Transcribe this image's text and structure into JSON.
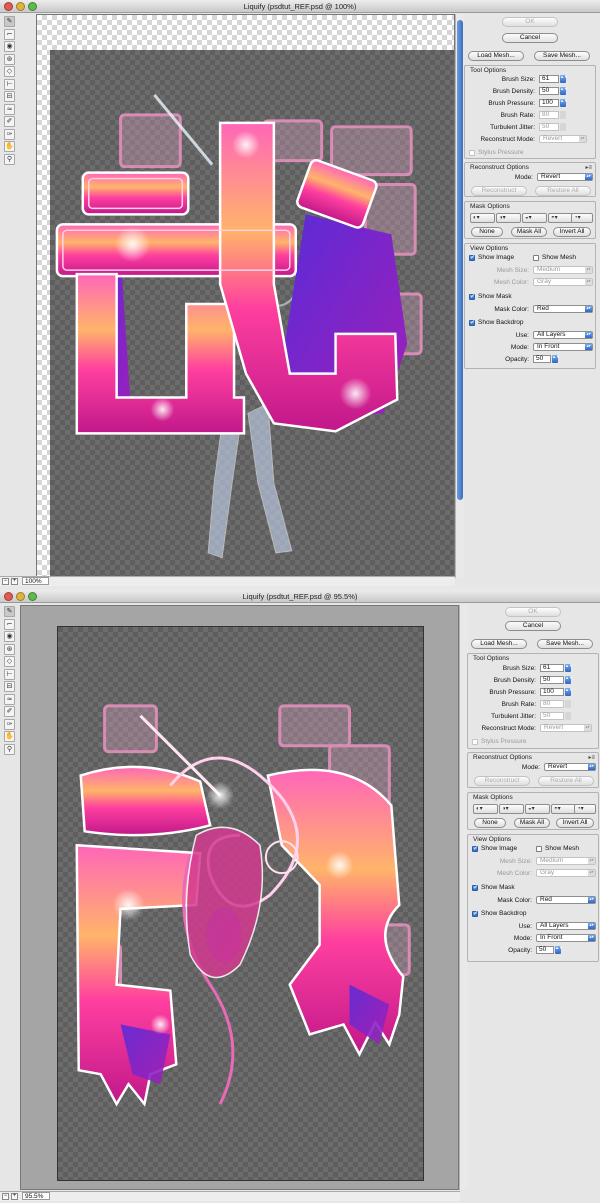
{
  "windows": [
    {
      "title": "Liquify (psdtut_REF.psd @ 100%)",
      "zoom": "100%",
      "stage": "before"
    },
    {
      "title": "Liquify (psdtut_REF.psd @ 95.5%)",
      "zoom": "95.5%",
      "stage": "after"
    }
  ],
  "tools": [
    "forward-warp",
    "reconstruct",
    "twirl",
    "pucker",
    "bloat",
    "push-left",
    "mirror",
    "turbulence",
    "freeze-mask",
    "thaw-mask",
    "hand",
    "zoom"
  ],
  "buttons": {
    "ok": "OK",
    "cancel": "Cancel",
    "load_mesh": "Load Mesh...",
    "save_mesh": "Save Mesh..."
  },
  "tool_options": {
    "header": "Tool Options",
    "brush_size_label": "Brush Size:",
    "brush_size": "61",
    "brush_density_label": "Brush Density:",
    "brush_density": "50",
    "brush_pressure_label": "Brush Pressure:",
    "brush_pressure": "100",
    "brush_rate_label": "Brush Rate:",
    "brush_rate": "80",
    "turbulent_jitter_label": "Turbulent Jitter:",
    "turbulent_jitter": "50",
    "reconstruct_mode_label": "Reconstruct Mode:",
    "reconstruct_mode": "Revert",
    "stylus_pressure_label": "Stylus Pressure"
  },
  "reconstruct_options": {
    "header": "Reconstruct Options",
    "mode_label": "Mode:",
    "mode": "Revert",
    "reconstruct": "Reconstruct",
    "restore_all": "Restore All"
  },
  "mask_options": {
    "header": "Mask Options",
    "none": "None",
    "mask_all": "Mask All",
    "invert_all": "Invert All"
  },
  "view_options": {
    "header": "View Options",
    "show_image": "Show Image",
    "show_mesh": "Show Mesh",
    "mesh_size_label": "Mesh Size:",
    "mesh_size": "Medium",
    "mesh_color_label": "Mesh Color:",
    "mesh_color": "Gray",
    "show_mask": "Show Mask",
    "mask_color_label": "Mask Color:",
    "mask_color": "Red",
    "show_backdrop": "Show Backdrop",
    "use_label": "Use:",
    "use": "All Layers",
    "mode_label": "Mode:",
    "mode": "In Front",
    "opacity_label": "Opacity:",
    "opacity": "50"
  },
  "colors": {
    "accent": "#3a6cc0",
    "art_pink": "#ff3f9f",
    "art_orange": "#ff9a3c",
    "art_purple": "#7a1fd0",
    "art_cyan": "#7fe9ff"
  }
}
